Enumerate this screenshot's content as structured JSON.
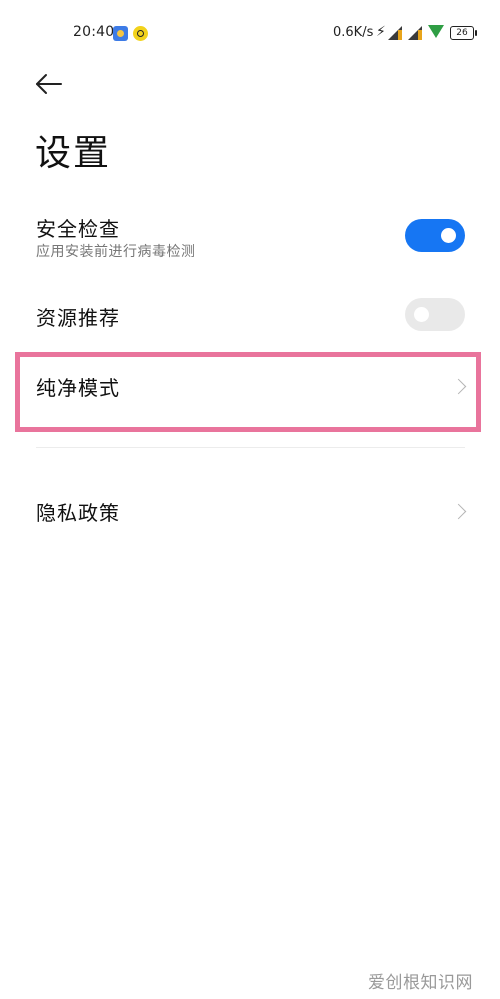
{
  "status_bar": {
    "time": "20:40",
    "net_speed": "0.6K/s",
    "battery": "26",
    "icons": [
      "app-notification-icon",
      "app-notification-icon-2",
      "bluetooth-icon",
      "signal-icon",
      "signal-icon-2",
      "wifi-icon",
      "battery-icon"
    ]
  },
  "header": {
    "back_icon": "arrow-left-icon",
    "title": "设置"
  },
  "settings": {
    "security_check": {
      "title": "安全检查",
      "subtitle": "应用安装前进行病毒检测",
      "enabled": true
    },
    "resource_recommend": {
      "title": "资源推荐",
      "enabled": false
    },
    "pure_mode": {
      "title": "纯净模式"
    },
    "privacy_policy": {
      "title": "隐私政策"
    }
  },
  "colors": {
    "toggle_on": "#1676f3",
    "toggle_off": "#e9e9e9",
    "highlight": "#e9749c"
  },
  "watermark": "爱创根知识网"
}
